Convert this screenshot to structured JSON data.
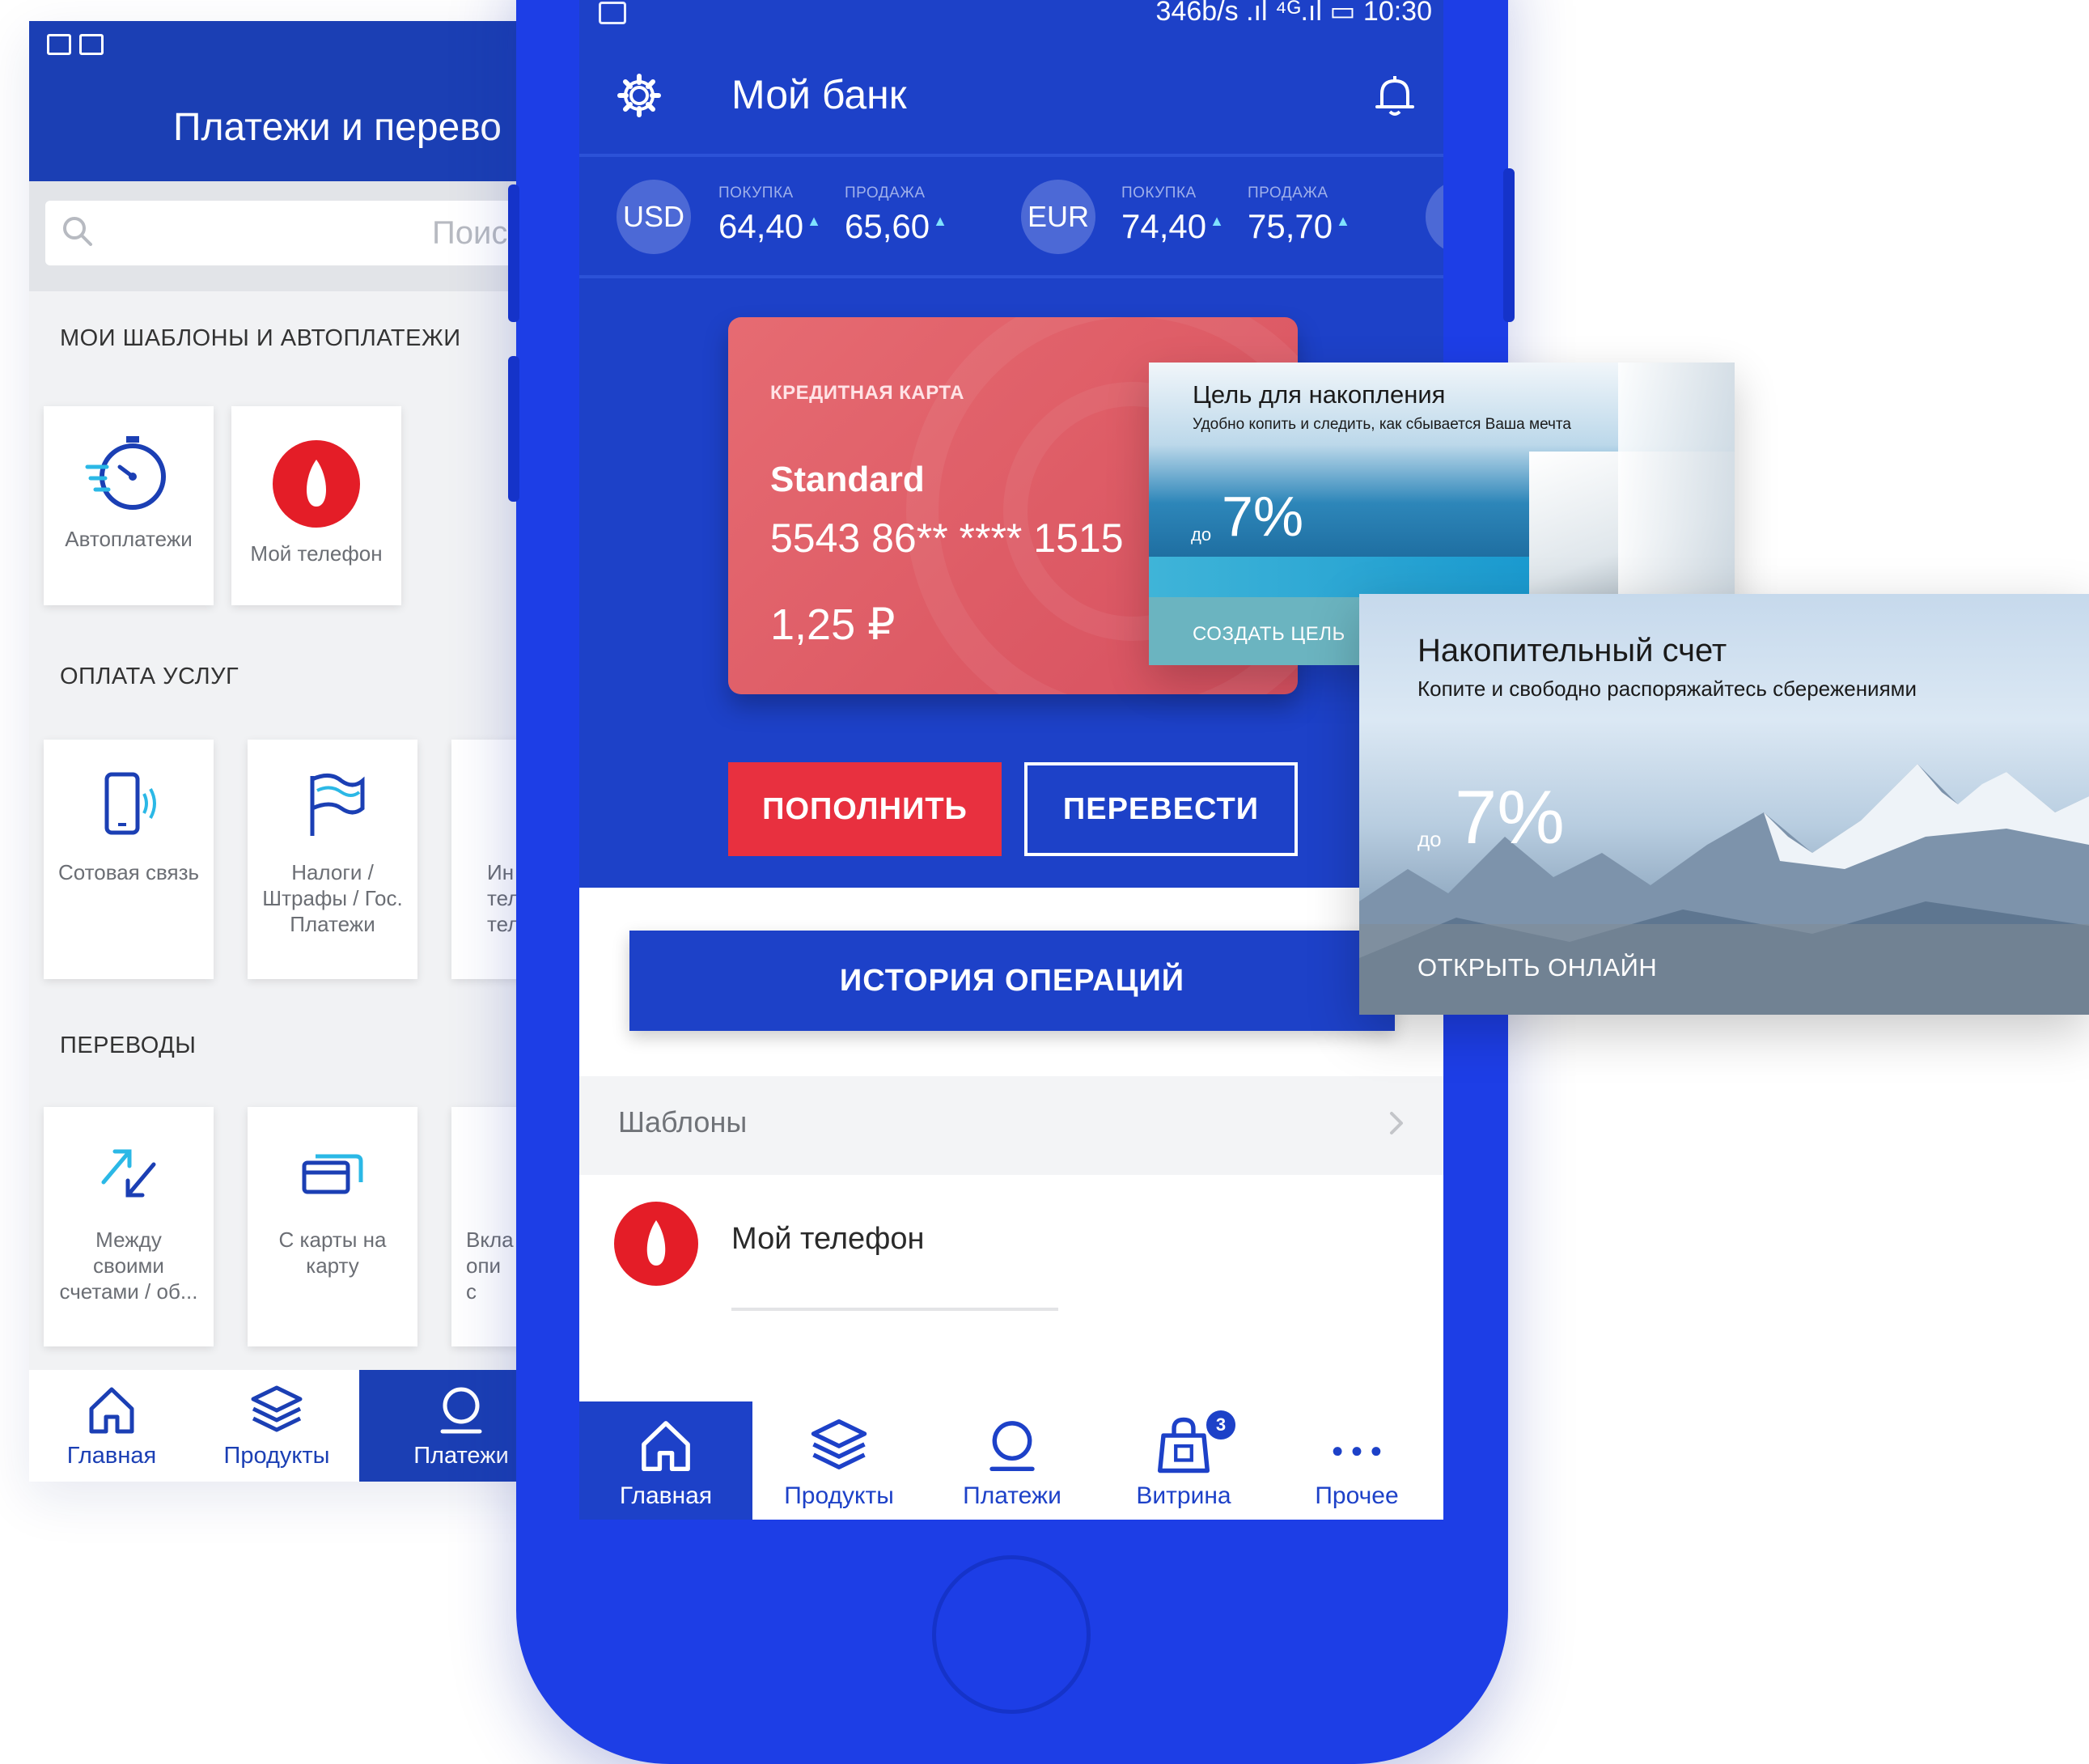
{
  "colors": {
    "brand_blue": "#1d41c8",
    "phone_body": "#1d3ee6",
    "accent_red": "#e8303f",
    "card_red": "#e0626b",
    "rate_up": "#7fe2ff"
  },
  "left_screen": {
    "title": "Платежи и перево",
    "search_placeholder": "Поиск",
    "section_templates": "МОИ ШАБЛОНЫ И АВТОПЛАТЕЖИ",
    "templates": [
      {
        "label": "Автоплатежи",
        "icon": "stopwatch-icon"
      },
      {
        "label": "Мой телефон",
        "icon": "mts-egg-logo"
      }
    ],
    "section_services": "ОПЛАТА УСЛУГ",
    "services": [
      {
        "label": "Сотовая связь",
        "icon": "mobile-phone-icon"
      },
      {
        "label": "Налоги /\nШтрафы / Гос.\nПлатежи",
        "icon": "flag-icon"
      },
      {
        "label": "Ин\nтеле\nтел",
        "icon": "partial-icon"
      }
    ],
    "section_transfers": "ПЕРЕВОДЫ",
    "transfers": [
      {
        "label": "Между\nсвоими\nсчетами / об...",
        "icon": "arrows-exchange-icon"
      },
      {
        "label": "С карты на\nкарту",
        "icon": "cards-icon"
      },
      {
        "label": "Вкла\nопи\nс",
        "icon": "partial-icon"
      }
    ],
    "nav": [
      {
        "label": "Главная",
        "icon": "home-icon",
        "active": false
      },
      {
        "label": "Продукты",
        "icon": "layers-icon",
        "active": false
      },
      {
        "label": "Платежи",
        "icon": "payments-icon",
        "active": true
      }
    ]
  },
  "main_screen": {
    "status_bar": {
      "text": "346b/s  .ıl  ⁴ᴳ.ıl  ▭ 10:30"
    },
    "title": "Мой банк",
    "rates": {
      "buy_label": "ПОКУПКА",
      "sell_label": "ПРОДАЖА",
      "items": [
        {
          "code": "USD",
          "buy": "64,40",
          "sell": "65,60"
        },
        {
          "code": "EUR",
          "buy": "74,40",
          "sell": "75,70"
        }
      ]
    },
    "card": {
      "type": "КРЕДИТНАЯ КАРТА",
      "name": "Standard",
      "number": "5543 86** **** 1515",
      "balance": "1,25 ₽"
    },
    "buttons": {
      "topup": "ПОПОЛНИТЬ",
      "transfer": "ПЕРЕВЕСТИ",
      "history": "ИСТОРИЯ ОПЕРАЦИЙ"
    },
    "templates": {
      "label": "Шаблоны",
      "item": "Мой телефон"
    },
    "nav": [
      {
        "label": "Главная",
        "icon": "home-icon",
        "active": true
      },
      {
        "label": "Продукты",
        "icon": "layers-icon",
        "active": false
      },
      {
        "label": "Платежи",
        "icon": "payments-icon",
        "active": false
      },
      {
        "label": "Витрина",
        "icon": "shopping-bag-icon",
        "active": false,
        "badge": "3"
      },
      {
        "label": "Прочее",
        "icon": "more-dots-icon",
        "active": false
      }
    ]
  },
  "promo_goal": {
    "title": "Цель для накопления",
    "subtitle": "Удобно копить и следить, как сбывается Ваша мечта",
    "rate_prefix": "до",
    "rate": "7%",
    "cta": "СОЗДАТЬ ЦЕЛЬ"
  },
  "promo_account": {
    "title": "Накопительный счет",
    "subtitle": "Копите и свободно распоряжайтесь сбережениями",
    "rate_prefix": "до",
    "rate": "7%",
    "cta": "ОТКРЫТЬ ОНЛАЙН"
  }
}
